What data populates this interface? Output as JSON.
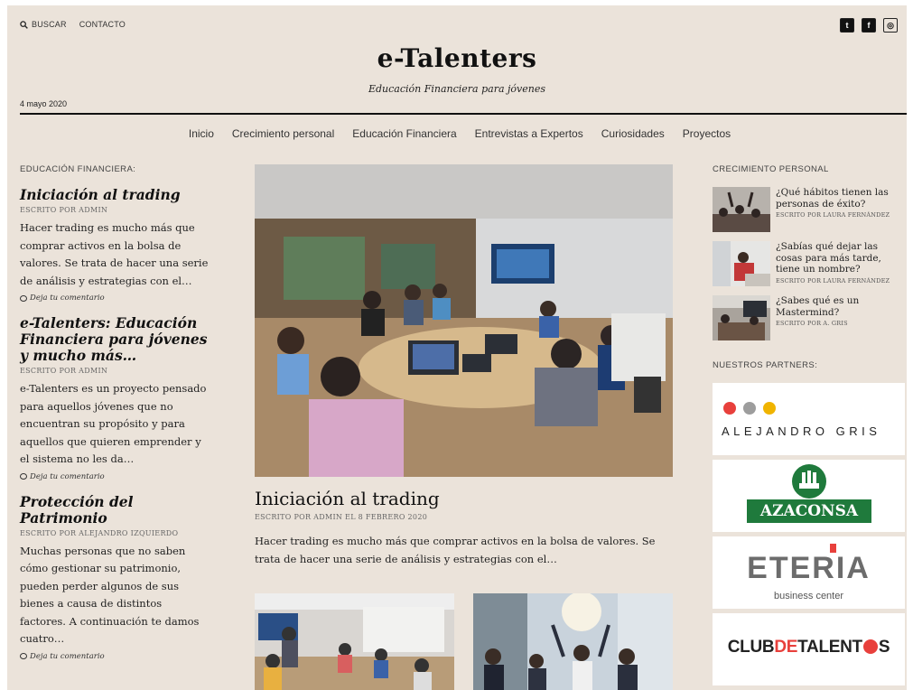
{
  "topbar": {
    "search": "BUSCAR",
    "contact": "CONTACTO"
  },
  "social": {
    "twitter": "t",
    "facebook": "f",
    "instagram": "◎"
  },
  "site": {
    "title": "e-Talenters",
    "tagline": "Educación Financiera para jóvenes",
    "date": "4 mayo 2020"
  },
  "nav": [
    "Inicio",
    "Crecimiento personal",
    "Educación Financiera",
    "Entrevistas a Expertos",
    "Curiosidades",
    "Proyectos"
  ],
  "left": {
    "heading": "EDUCACIÓN FINANCIERA:",
    "posts": [
      {
        "title": "Iniciación al trading",
        "byline": "ESCRITO POR ADMIN",
        "excerpt": "Hacer trading es mucho más que comprar activos en la bolsa de valores. Se trata de hacer una serie de análisis y estrategias con el…",
        "comment": "Deja tu comentario"
      },
      {
        "title": "e-Talenters: Educación Financiera para jóvenes y mucho más…",
        "byline": "ESCRITO POR ADMIN",
        "excerpt": "e-Talenters es un proyecto pensado para aquellos jóvenes que no encuentran su propósito y para aquellos que quieren emprender y el sistema no les da…",
        "comment": "Deja tu comentario"
      },
      {
        "title": "Protección del Patrimonio",
        "byline": "ESCRITO POR ALEJANDRO IZQUIERDO",
        "excerpt": "Muchas personas que no saben cómo gestionar su patrimonio, pueden perder algunos de sus bienes a causa de distintos factores. A continuación te damos cuatro…",
        "comment": "Deja tu comentario"
      }
    ]
  },
  "main": {
    "title": "Iniciación al trading",
    "byline": "ESCRITO POR ADMIN EL 8 FEBRERO 2020",
    "excerpt": "Hacer trading es mucho más que comprar activos en la bolsa de valores. Se trata de hacer una serie de análisis y estrategias con el…"
  },
  "right": {
    "heading": "CRECIMIENTO PERSONAL",
    "posts": [
      {
        "title": "¿Qué hábitos tienen las personas de éxito?",
        "byline": "ESCRITO POR LAURA FERNÁNDEZ"
      },
      {
        "title": "¿Sabías qué dejar las cosas para más tarde, tiene un nombre?",
        "byline": "ESCRITO POR LAURA FERNÁNDEZ"
      },
      {
        "title": "¿Sabes qué es un Mastermind?",
        "byline": "ESCRITO POR A. GRIS"
      }
    ],
    "partners_heading": "NUESTROS PARTNERS:",
    "partners": {
      "alejandro": "ALEJANDRO GRIS",
      "azaconsa": "AZACONSA",
      "eteria": "ETERIA",
      "eteria_sub": "business center",
      "club_a": "CLUB",
      "club_b": "DE",
      "club_c": "TALENT",
      "club_d": "S"
    }
  },
  "colors": {
    "background": "#ebe3da",
    "accent_red": "#e8403c",
    "azaconsa_green": "#1f7a3c"
  }
}
